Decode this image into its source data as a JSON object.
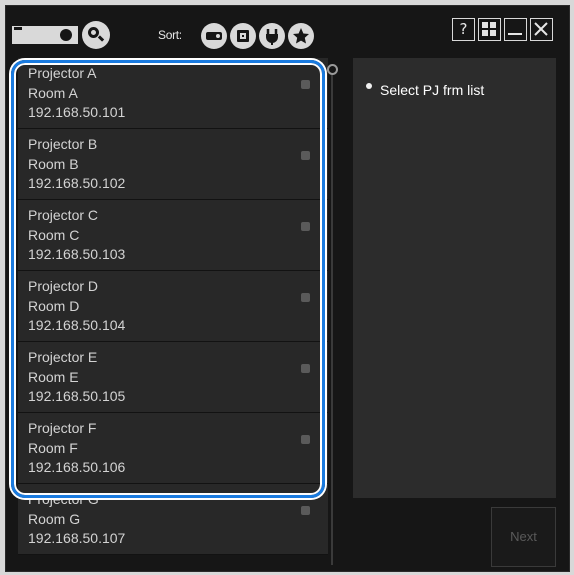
{
  "toolbar": {
    "projector_icon": "projector-icon",
    "search_icon": "search-icon",
    "sort_label": "Sort:",
    "sort_buttons": [
      "projector-sort-icon",
      "input-sort-icon",
      "power-sort-icon",
      "favorite-sort-icon"
    ]
  },
  "window_buttons": {
    "help": "?",
    "layout": "⊞",
    "minimize": "—",
    "close": "✕"
  },
  "projectors": [
    {
      "name": "Projector A",
      "room": "Room A",
      "ip": "192.168.50.101"
    },
    {
      "name": "Projector B",
      "room": "Room B",
      "ip": "192.168.50.102"
    },
    {
      "name": "Projector C",
      "room": "Room C",
      "ip": "192.168.50.103"
    },
    {
      "name": "Projector D",
      "room": "Room D",
      "ip": "192.168.50.104"
    },
    {
      "name": "Projector E",
      "room": "Room E",
      "ip": "192.168.50.105"
    },
    {
      "name": "Projector F",
      "room": "Room F",
      "ip": "192.168.50.106"
    },
    {
      "name": "Projector G",
      "room": "Room G",
      "ip": "192.168.50.107"
    }
  ],
  "info": {
    "message": "Select PJ frm list"
  },
  "next_label": "Next",
  "colors": {
    "highlight": "#1a7be0",
    "background": "#161616",
    "item": "#282828"
  }
}
